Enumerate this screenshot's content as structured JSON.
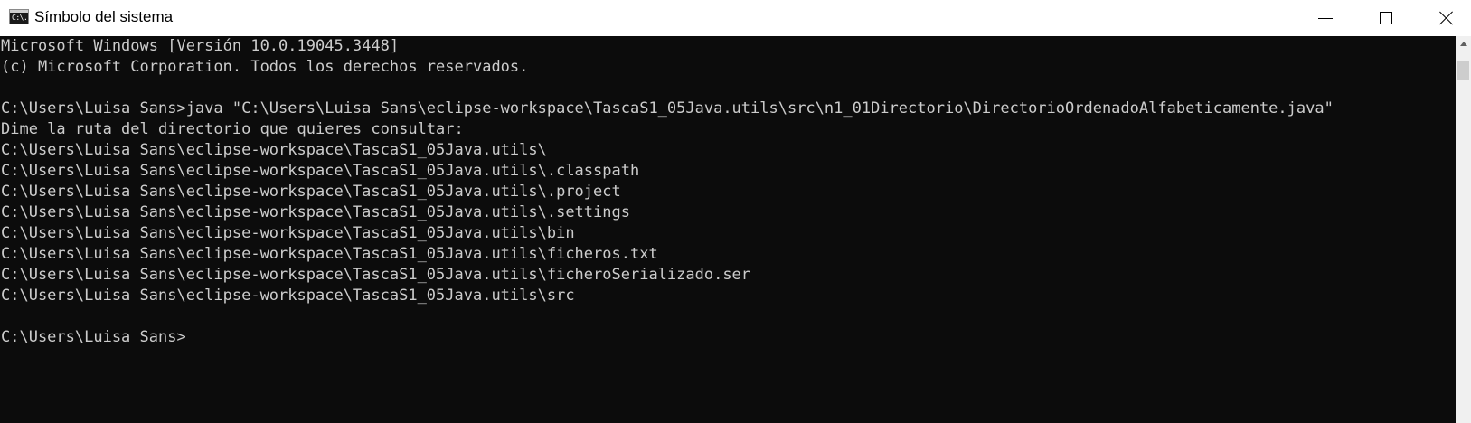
{
  "window": {
    "title": "Símbolo del sistema",
    "icon_text": "C:\\."
  },
  "console": {
    "lines": [
      "Microsoft Windows [Versión 10.0.19045.3448]",
      "(c) Microsoft Corporation. Todos los derechos reservados.",
      "",
      "C:\\Users\\Luisa Sans>java \"C:\\Users\\Luisa Sans\\eclipse-workspace\\TascaS1_05Java.utils\\src\\n1_01Directorio\\DirectorioOrdenadoAlfabeticamente.java\"",
      "Dime la ruta del directorio que quieres consultar:",
      "C:\\Users\\Luisa Sans\\eclipse-workspace\\TascaS1_05Java.utils\\",
      "C:\\Users\\Luisa Sans\\eclipse-workspace\\TascaS1_05Java.utils\\.classpath",
      "C:\\Users\\Luisa Sans\\eclipse-workspace\\TascaS1_05Java.utils\\.project",
      "C:\\Users\\Luisa Sans\\eclipse-workspace\\TascaS1_05Java.utils\\.settings",
      "C:\\Users\\Luisa Sans\\eclipse-workspace\\TascaS1_05Java.utils\\bin",
      "C:\\Users\\Luisa Sans\\eclipse-workspace\\TascaS1_05Java.utils\\ficheros.txt",
      "C:\\Users\\Luisa Sans\\eclipse-workspace\\TascaS1_05Java.utils\\ficheroSerializado.ser",
      "C:\\Users\\Luisa Sans\\eclipse-workspace\\TascaS1_05Java.utils\\src",
      "",
      "C:\\Users\\Luisa Sans>"
    ]
  },
  "icons": {
    "app": "console-app-icon",
    "minimize": "minimize-icon",
    "maximize": "maximize-icon",
    "close": "close-icon",
    "scroll_up": "chevron-up-icon"
  },
  "colors": {
    "console_bg": "#0c0c0c",
    "console_text": "#cccccc",
    "titlebar_bg": "#ffffff"
  }
}
